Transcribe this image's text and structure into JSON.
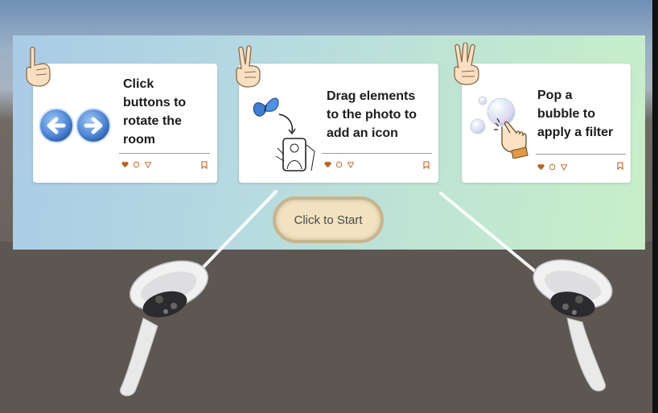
{
  "cards": [
    {
      "text": "Click\nbuttons to\nrotate the\nroom",
      "gesture": "one-finger-hand-icon",
      "illustration": "rotate-arrows-icon"
    },
    {
      "text": "Drag elements\nto the photo to\nadd an icon",
      "gesture": "two-finger-hand-icon",
      "illustration": "butterfly-phone-icon"
    },
    {
      "text": "Pop a\nbubble to\napply a filter",
      "gesture": "three-finger-hand-icon",
      "illustration": "bubble-tap-icon"
    }
  ],
  "start_button": {
    "label": "Click to Start"
  },
  "colors": {
    "heart": "#c0601e",
    "accent_orange": "#d7883a",
    "button_fill": "#f1e3bf",
    "arrow_button": "#4c86d6"
  }
}
